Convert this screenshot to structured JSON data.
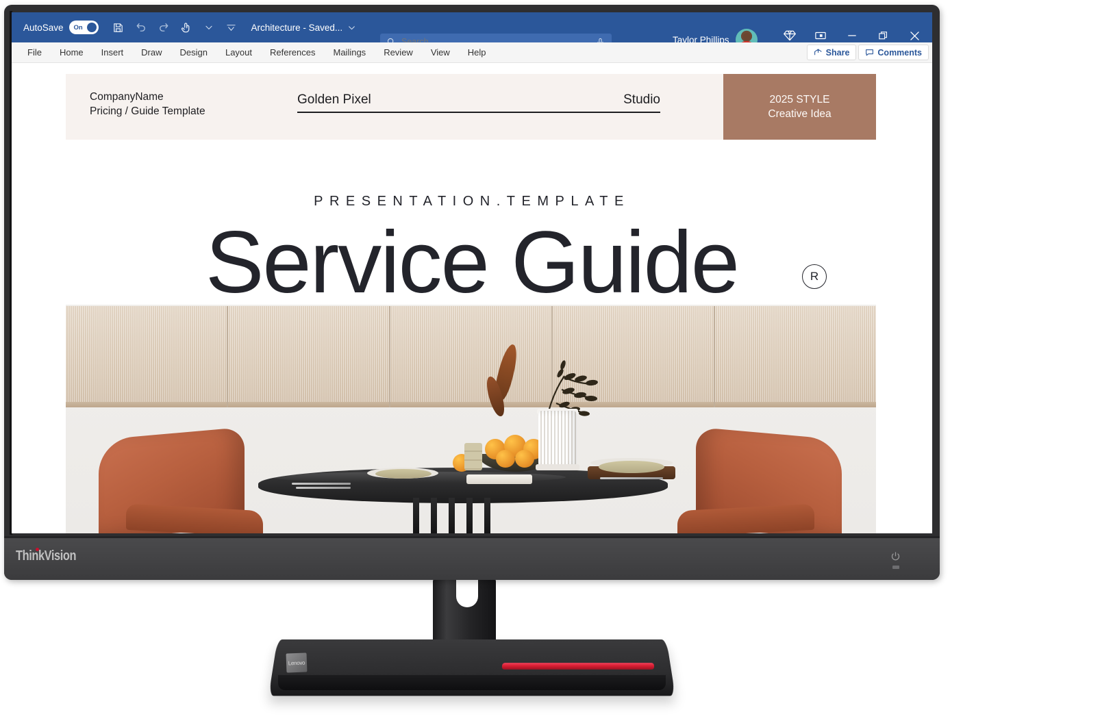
{
  "app": {
    "titlebar": {
      "autosave_label": "AutoSave",
      "autosave_state": "On",
      "document_name": "Architecture - Saved...",
      "account_name": "Taylor Phillips",
      "icons": {
        "save": "save-icon",
        "undo": "undo-icon",
        "redo": "redo-icon",
        "touch_mode": "touch-mode-icon",
        "customize_qat": "chevron-down-icon",
        "more_commands": "overflow-icon",
        "doc_menu": "chevron-down-icon",
        "copilot": "diamond-icon",
        "ribbon_display": "ribbon-display-options-icon",
        "minimize": "minimize-icon",
        "restore": "restore-icon",
        "close": "close-icon",
        "avatar": "user-avatar"
      }
    },
    "search": {
      "placeholder": "Search",
      "icon": "search-icon",
      "dictate_icon": "microphone-icon"
    },
    "ribbon": {
      "tabs": [
        "File",
        "Home",
        "Insert",
        "Draw",
        "Design",
        "Layout",
        "References",
        "Mailings",
        "Review",
        "View",
        "Help"
      ],
      "share_label": "Share",
      "comments_label": "Comments",
      "share_icon": "share-icon",
      "comments_icon": "comment-bubble-icon"
    }
  },
  "document": {
    "header": {
      "company_name": "CompanyName",
      "company_subtitle": "Pricing / Guide Template",
      "brand_left": "Golden Pixel",
      "brand_right": "Studio",
      "badge_line1": "2025 STYLE",
      "badge_line2": "Creative Idea",
      "badge_color": "#a87a64",
      "strip_color": "#f7f2ef"
    },
    "body": {
      "kicker": "PRESENTATION.TEMPLATE",
      "title": "Service Guide",
      "trademark_symbol": "R",
      "photo_alt": "dining-room-photo"
    }
  },
  "hardware": {
    "brand_logo": "ThinkVision",
    "base_badge": "Lenovo",
    "power_icon": "power-icon",
    "accent_color": "#d81e32",
    "bezel_color": "#2e2e30"
  }
}
